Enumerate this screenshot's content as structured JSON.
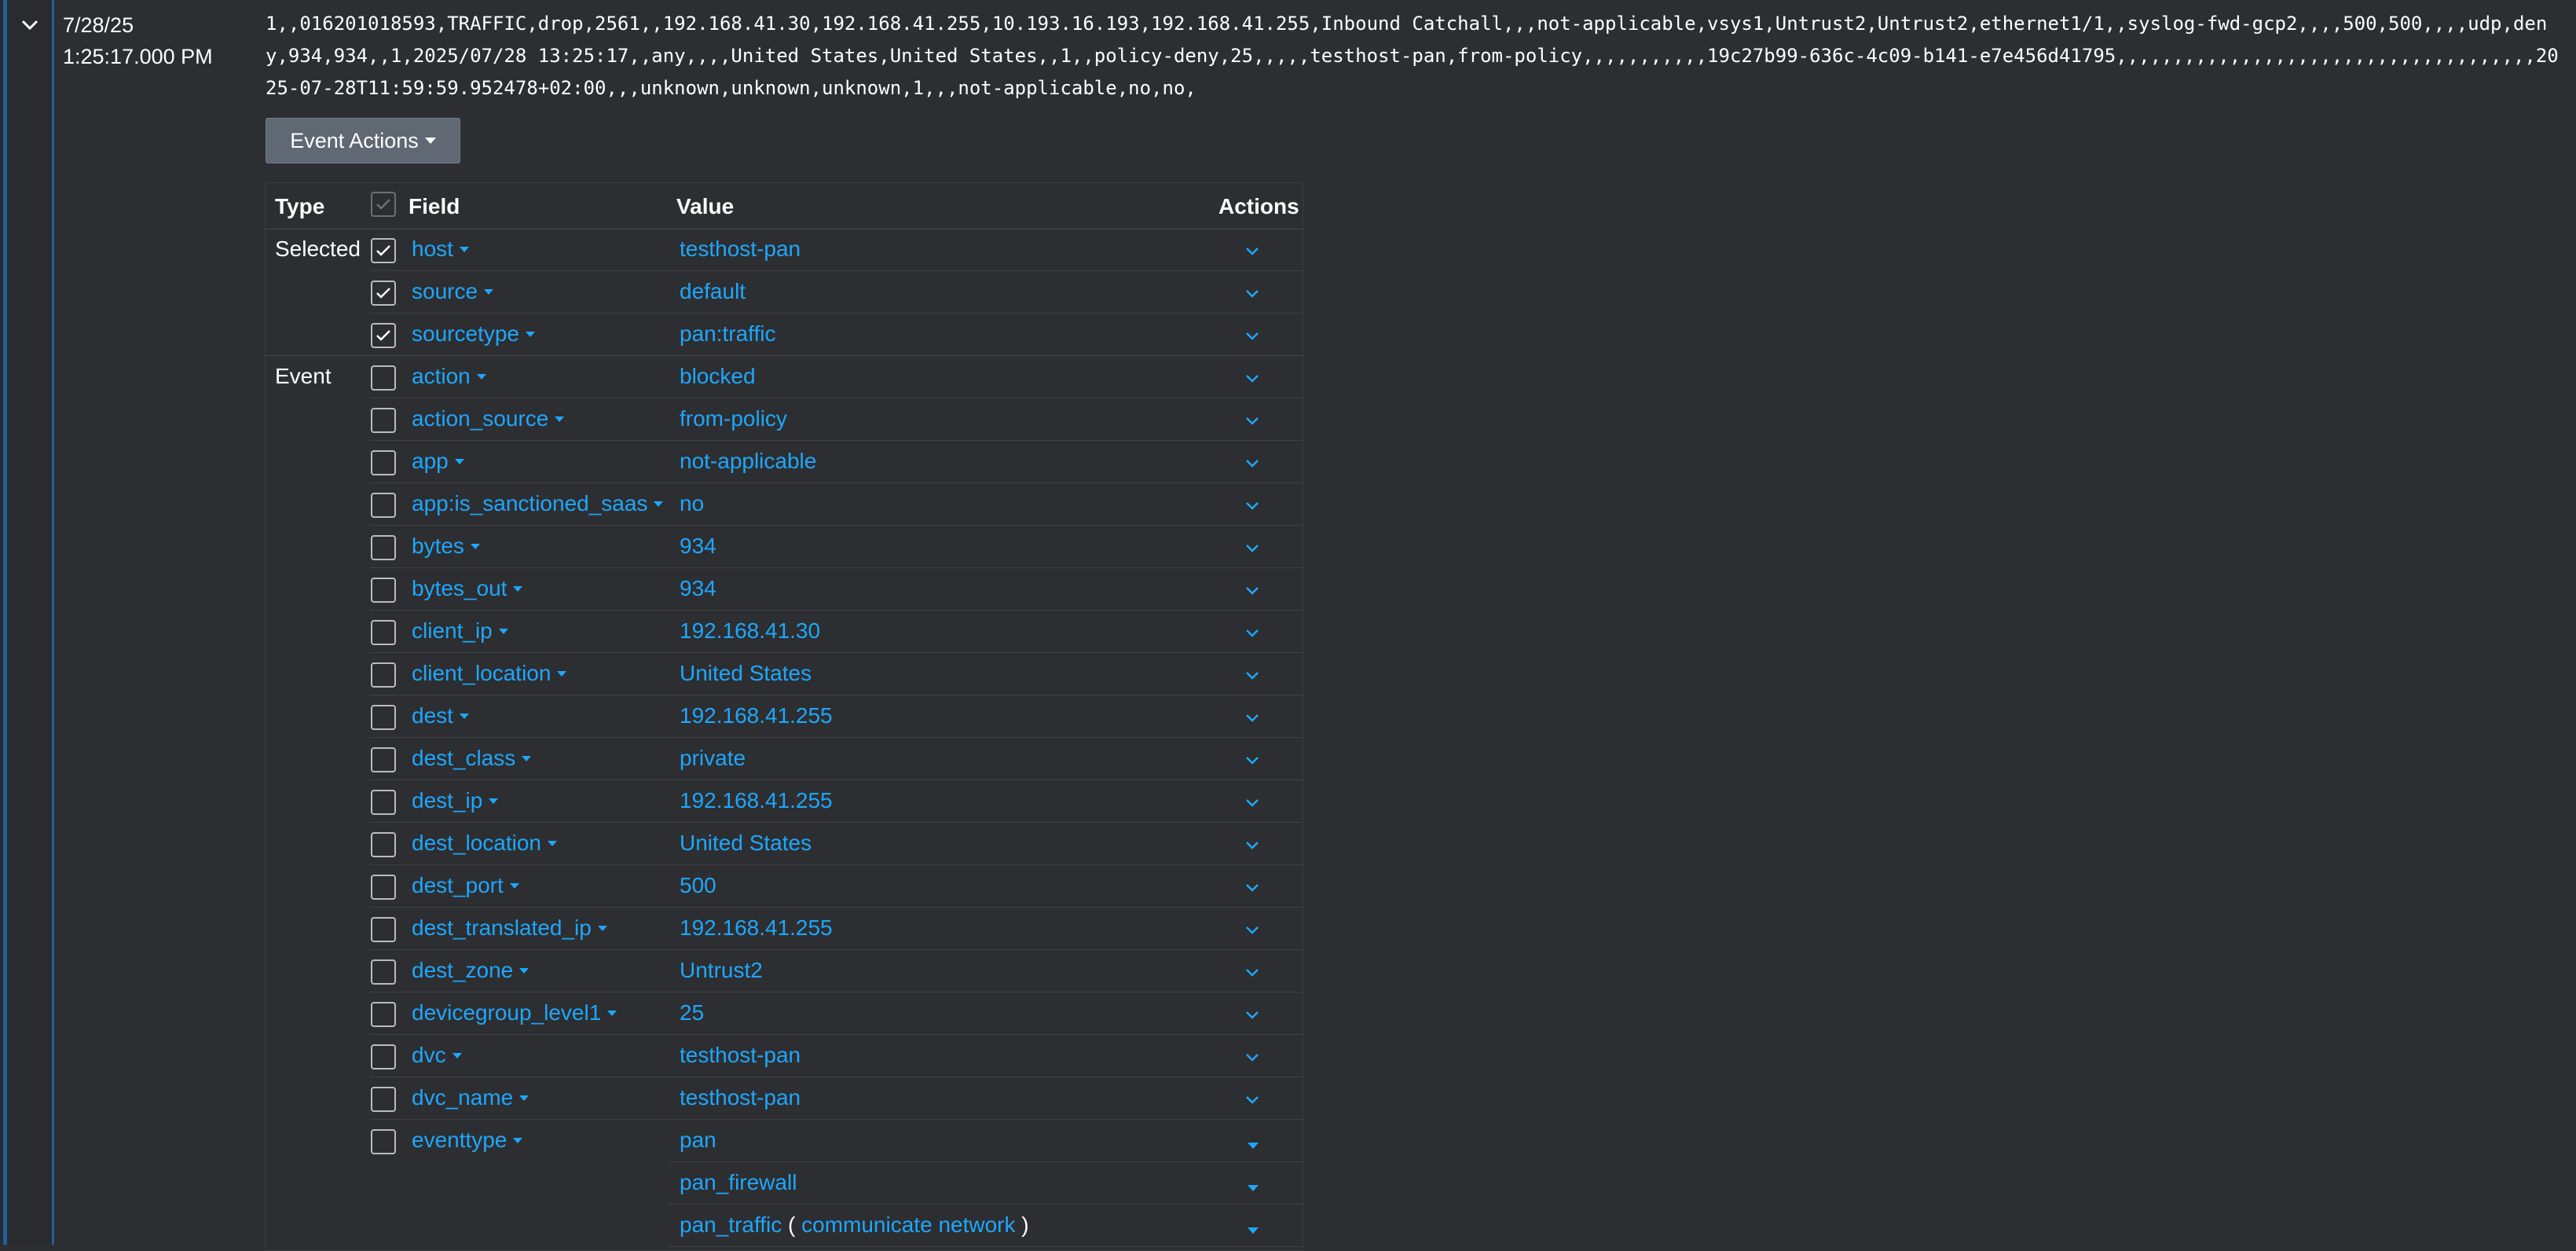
{
  "event": {
    "date": "7/28/25",
    "time": "1:25:17.000 PM",
    "raw": "1,,016201018593,TRAFFIC,drop,2561,,192.168.41.30,192.168.41.255,10.193.16.193,192.168.41.255,Inbound Catchall,,,not-applicable,vsys1,Untrust2,Untrust2,ethernet1/1,,syslog-fwd-gcp2,,,,500,500,,,,udp,deny,934,934,,1,2025/07/28 13:25:17,,any,,,,United States,United States,,1,,policy-deny,25,,,,,testhost-pan,from-policy,,,,,,,,,,,19c27b99-636c-4c09-b141-e7e456d41795,,,,,,,,,,,,,,,,,,,,,,,,,,,,,,,,,,,,,2025-07-28T11:59:59.952478+02:00,,,unknown,unknown,unknown,1,,,not-applicable,no,no,",
    "event_actions_label": "Event Actions"
  },
  "table": {
    "headers": {
      "type": "Type",
      "field": "Field",
      "value": "Value",
      "actions": "Actions"
    },
    "selected_label": "Selected",
    "event_label": "Event",
    "selected": [
      {
        "field": "host",
        "value": "testhost-pan"
      },
      {
        "field": "source",
        "value": "default"
      },
      {
        "field": "sourcetype",
        "value": "pan:traffic"
      }
    ],
    "event_fields": [
      {
        "field": "action",
        "value": "blocked"
      },
      {
        "field": "action_source",
        "value": "from-policy"
      },
      {
        "field": "app",
        "value": "not-applicable"
      },
      {
        "field": "app:is_sanctioned_saas",
        "value": "no"
      },
      {
        "field": "bytes",
        "value": "934"
      },
      {
        "field": "bytes_out",
        "value": "934"
      },
      {
        "field": "client_ip",
        "value": "192.168.41.30"
      },
      {
        "field": "client_location",
        "value": "United States"
      },
      {
        "field": "dest",
        "value": "192.168.41.255"
      },
      {
        "field": "dest_class",
        "value": "private"
      },
      {
        "field": "dest_ip",
        "value": "192.168.41.255"
      },
      {
        "field": "dest_location",
        "value": "United States"
      },
      {
        "field": "dest_port",
        "value": "500"
      },
      {
        "field": "dest_translated_ip",
        "value": "192.168.41.255"
      },
      {
        "field": "dest_zone",
        "value": "Untrust2"
      },
      {
        "field": "devicegroup_level1",
        "value": "25"
      },
      {
        "field": "dvc",
        "value": "testhost-pan"
      },
      {
        "field": "dvc_name",
        "value": "testhost-pan"
      },
      {
        "field": "eventtype",
        "value": "pan"
      }
    ],
    "eventtype_extra": [
      {
        "value": "pan_firewall"
      },
      {
        "value": "pan_traffic",
        "open_paren": "(",
        "tag1": "communicate",
        "tag2": "network",
        "close_paren": ")"
      }
    ]
  },
  "colors": {
    "link": "#1ea7fd",
    "background": "#2d2e31",
    "button": "#5f6873",
    "accent": "#1f5f9e"
  }
}
